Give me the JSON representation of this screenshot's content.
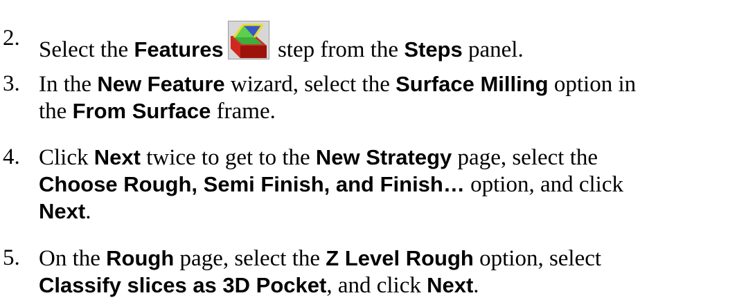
{
  "steps": [
    {
      "num": "2.",
      "t1": "Select the ",
      "b1": "Features",
      "t2": " step from the ",
      "b2": "Steps",
      "t3": " panel.",
      "icon": "features-step-icon"
    },
    {
      "num": "3.",
      "t1": "In the ",
      "b1": "New Feature",
      "t2": " wizard, select the ",
      "b2": "Surface Milling",
      "t3": " option in",
      "l2_t1": "the ",
      "l2_b1": "From Surface",
      "l2_t2": " frame."
    },
    {
      "num": "4.",
      "t1": "Click ",
      "b1": "Next",
      "t2": " twice to get to the ",
      "b2": "New Strategy",
      "t3": " page, select the",
      "l2_b1": "Choose Rough, Semi Finish, and Finish…",
      "l2_t1": " option, and click",
      "l3_b1": "Next",
      "l3_t1": "."
    },
    {
      "num": "5.",
      "t1": "On the ",
      "b1": "Rough",
      "t2": " page, select the ",
      "b2": "Z Level Rough",
      "t3": " option, select",
      "l2_b1": "Classify slices as 3D Pocket",
      "l2_t1": ", and click ",
      "l2_b2": "Next",
      "l2_t2": "."
    }
  ],
  "colors": {
    "icon_red": "#c0201a",
    "icon_green": "#3fae3a",
    "icon_blue": "#3a57c8",
    "icon_yellow": "#e8dc2a"
  }
}
